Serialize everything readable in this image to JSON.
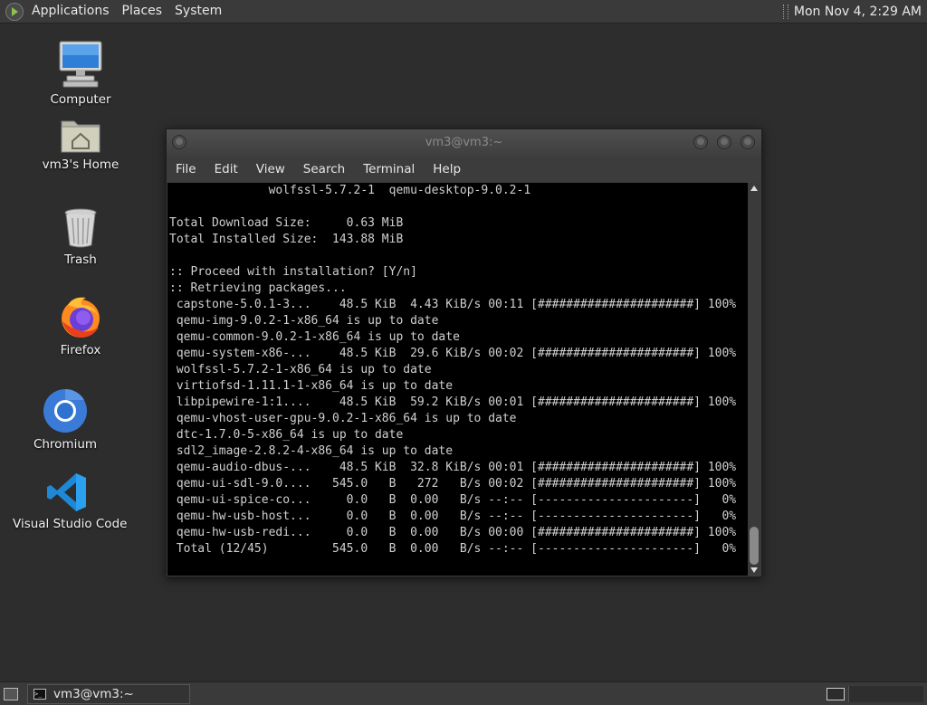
{
  "top_panel": {
    "menus": [
      "Applications",
      "Places",
      "System"
    ],
    "clock": "Mon Nov 4,  2:29 AM"
  },
  "desktop_icons": [
    {
      "label": "Computer",
      "icon": "computer-icon"
    },
    {
      "label": "vm3's Home",
      "icon": "home-folder-icon"
    },
    {
      "label": "Trash",
      "icon": "trash-icon"
    },
    {
      "label": "Firefox",
      "icon": "firefox-icon"
    },
    {
      "label": "Chromium",
      "icon": "chromium-icon"
    },
    {
      "label": "Visual Studio Code",
      "icon": "vscode-icon"
    }
  ],
  "terminal": {
    "title": "vm3@vm3:~",
    "menu": [
      "File",
      "Edit",
      "View",
      "Search",
      "Terminal",
      "Help"
    ],
    "lines": [
      "              wolfssl-5.7.2-1  qemu-desktop-9.0.2-1",
      "",
      "Total Download Size:     0.63 MiB",
      "Total Installed Size:  143.88 MiB",
      "",
      ":: Proceed with installation? [Y/n]",
      ":: Retrieving packages...",
      " capstone-5.0.1-3...    48.5 KiB  4.43 KiB/s 00:11 [######################] 100%",
      " qemu-img-9.0.2-1-x86_64 is up to date",
      " qemu-common-9.0.2-1-x86_64 is up to date",
      " qemu-system-x86-...    48.5 KiB  29.6 KiB/s 00:02 [######################] 100%",
      " wolfssl-5.7.2-1-x86_64 is up to date",
      " virtiofsd-1.11.1-1-x86_64 is up to date",
      " libpipewire-1:1....    48.5 KiB  59.2 KiB/s 00:01 [######################] 100%",
      " qemu-vhost-user-gpu-9.0.2-1-x86_64 is up to date",
      " dtc-1.7.0-5-x86_64 is up to date",
      " sdl2_image-2.8.2-4-x86_64 is up to date",
      " qemu-audio-dbus-...    48.5 KiB  32.8 KiB/s 00:01 [######################] 100%",
      " qemu-ui-sdl-9.0....   545.0   B   272   B/s 00:02 [######################] 100%",
      " qemu-ui-spice-co...     0.0   B  0.00   B/s --:-- [----------------------]   0%",
      " qemu-hw-usb-host...     0.0   B  0.00   B/s --:-- [----------------------]   0%",
      " qemu-hw-usb-redi...     0.0   B  0.00   B/s 00:00 [######################] 100%",
      " Total (12/45)         545.0   B  0.00   B/s --:-- [----------------------]   0%"
    ]
  },
  "taskbar": {
    "window_label": "vm3@vm3:~"
  },
  "colors": {
    "terminal_bg": "#000000",
    "terminal_fg": "#d0d0d0",
    "panel_bg": "#3a3a3a",
    "desktop_bg": "#2d2d2d"
  }
}
